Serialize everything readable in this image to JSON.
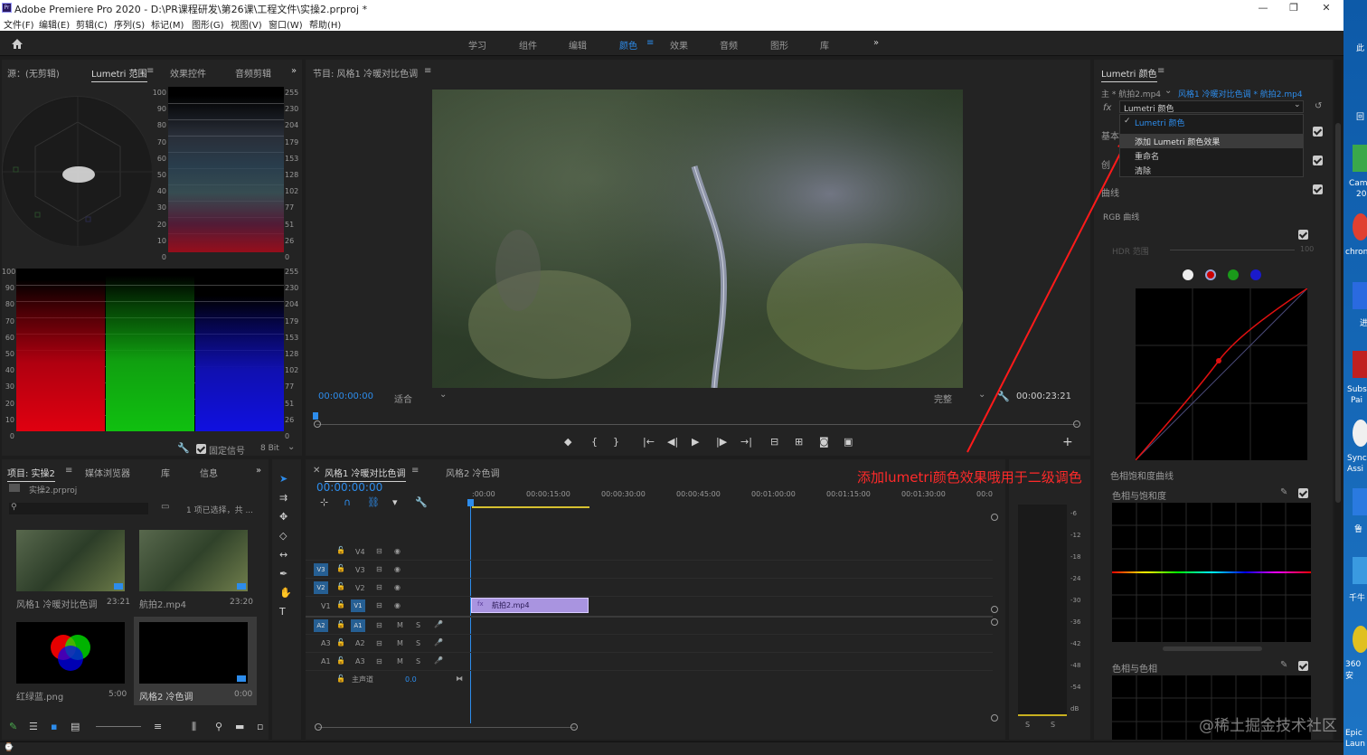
{
  "app": {
    "title": "Adobe Premiere Pro 2020 - D:\\PR课程研发\\第26课\\工程文件\\实操2.prproj *",
    "badge": "Pr",
    "min": "—",
    "max": "❐",
    "close": "✕"
  },
  "menu": [
    "文件(F)",
    "编辑(E)",
    "剪辑(C)",
    "序列(S)",
    "标记(M)",
    "图形(G)",
    "视图(V)",
    "窗口(W)",
    "帮助(H)"
  ],
  "workspaces": [
    "学习",
    "组件",
    "编辑",
    "颜色",
    "效果",
    "音频",
    "图形",
    "库"
  ],
  "ws_active": "颜色",
  "ws_more": "»",
  "source": {
    "tabs": [
      "源：(无剪辑)",
      "Lumetri 范围",
      "效果控件",
      "音频剪辑"
    ],
    "wave_left": [
      "100",
      "90",
      "80",
      "70",
      "60",
      "50",
      "40",
      "30",
      "20",
      "10",
      "0"
    ],
    "wave_right": [
      "255",
      "230",
      "204",
      "179",
      "153",
      "128",
      "102",
      "77",
      "51",
      "26",
      "0"
    ],
    "parade_left": [
      "100",
      "90",
      "80",
      "70",
      "60",
      "50",
      "40",
      "30",
      "20",
      "10",
      "0"
    ],
    "parade_right": [
      "255",
      "230",
      "204",
      "179",
      "153",
      "128",
      "102",
      "77",
      "51",
      "26",
      "0"
    ],
    "clamp_label": "固定信号",
    "bit": "8 Bit"
  },
  "program": {
    "title": "节目: 风格1 冷暖对比色调",
    "timecode": "00:00:00:00",
    "fit": "适合",
    "quality": "完整",
    "duration": "00:00:23:21"
  },
  "project": {
    "tabs": [
      "项目: 实操2",
      "媒体浏览器",
      "库",
      "信息"
    ],
    "file": "实操2.prproj",
    "selection": "1 项已选择，共 ...",
    "items": [
      {
        "name": "风格1 冷暖对比色调",
        "dur": "23:21"
      },
      {
        "name": "航拍2.mp4",
        "dur": "23:20"
      },
      {
        "name": "红绿蓝.png",
        "dur": "5:00"
      },
      {
        "name": "风格2 冷色调",
        "dur": "0:00"
      }
    ]
  },
  "timeline": {
    "tabs": [
      "风格1 冷暖对比色调",
      "风格2 冷色调"
    ],
    "timecode": "00:00:00:00",
    "ruler": [
      ":00:00",
      "00:00:15:00",
      "00:00:30:00",
      "00:00:45:00",
      "00:01:00:00",
      "00:01:15:00",
      "00:01:30:00",
      "00:0"
    ],
    "video_tracks": [
      "V4",
      "V3",
      "V2",
      "V1"
    ],
    "audio_tracks": [
      "A1",
      "A2",
      "A3"
    ],
    "audio_src": [
      "A2",
      "A3",
      "A1"
    ],
    "master": "主声道",
    "master_val": "0.0",
    "clip": "航拍2.mp4",
    "clip_fx": "fx",
    "m": "M",
    "s": "S"
  },
  "meter": {
    "scale": [
      "-6",
      "-12",
      "-18",
      "-24",
      "-30",
      "-36",
      "-42",
      "-48",
      "-54",
      "dB"
    ],
    "solo": "S"
  },
  "lumetri": {
    "title": "Lumetri 颜色",
    "source": "主 * 航拍2.mp4",
    "target": "风格1 冷暖对比色调 * 航拍2.mp4",
    "fx": "fx",
    "effect": "Lumetri 颜色",
    "menu_checked": "Lumetri 颜色",
    "menu_items": [
      "添加 Lumetri 颜色效果",
      "重命名",
      "清除"
    ],
    "sec_basic": "基本",
    "sec_creative": "创",
    "sec_curves": "曲线",
    "rgb": "RGB 曲线",
    "hdr": "HDR 范围",
    "hdr_val": "100",
    "huesat_curves": "色相饱和度曲线",
    "hue_vs_sat": "色相与饱和度",
    "hue_vs_hue": "色相与色相"
  },
  "annotation": "添加lumetri颜色效果哦用于二级调色",
  "watermark": "@稀土掘金技术社区",
  "desktop": [
    "此",
    "回",
    "Cam",
    "20",
    "chron",
    "进",
    "Subs",
    "Pai",
    "Sync",
    "Assi",
    "鲁",
    "千牛",
    "360安",
    "Epic",
    "Laun"
  ]
}
